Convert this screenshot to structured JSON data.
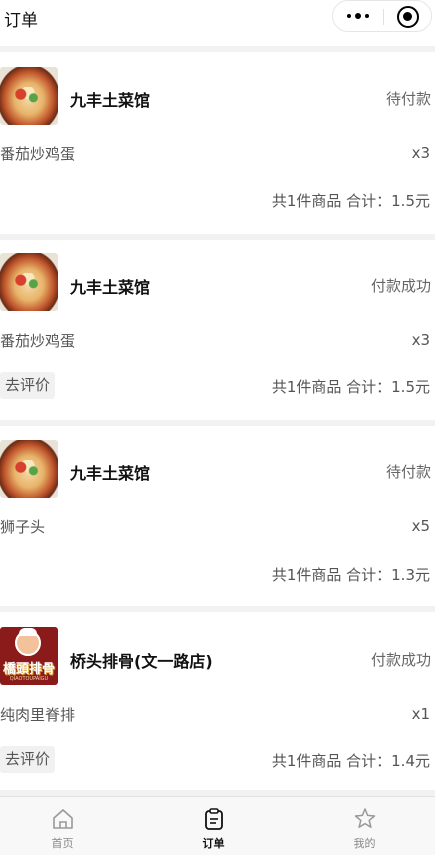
{
  "header": {
    "title": "订单"
  },
  "orders": [
    {
      "shop_name": "九丰土菜馆",
      "status": "待付款",
      "dish": "番茄炒鸡蛋",
      "qty": "x3",
      "summary": "共1件商品 合计：1.5元"
    },
    {
      "shop_name": "九丰土菜馆",
      "status": "付款成功",
      "dish": "番茄炒鸡蛋",
      "qty": "x3",
      "review": "去评价",
      "summary": "共1件商品 合计：1.5元"
    },
    {
      "shop_name": "九丰土菜馆",
      "status": "待付款",
      "dish": "狮子头",
      "qty": "x5",
      "summary": "共1件商品 合计：1.3元"
    },
    {
      "shop_name": "桥头排骨(文一路店)",
      "status": "付款成功",
      "dish": "纯肉里脊排",
      "qty": "x1",
      "review": "去评价",
      "summary": "共1件商品 合计：1.4元",
      "logo_text": "橋頭排骨",
      "logo_sub": "QIAOTOUPAIGU"
    }
  ],
  "tabbar": {
    "home": "首页",
    "orders": "订单",
    "mine": "我的"
  },
  "icons": {
    "more": "more-dots-icon",
    "close_target": "target-icon",
    "home": "home-icon",
    "orders": "clipboard-icon",
    "mine": "star-person-icon"
  },
  "colors": {
    "status_text": "#666666",
    "active_tab": "#111111",
    "inactive_tab": "#888888"
  }
}
